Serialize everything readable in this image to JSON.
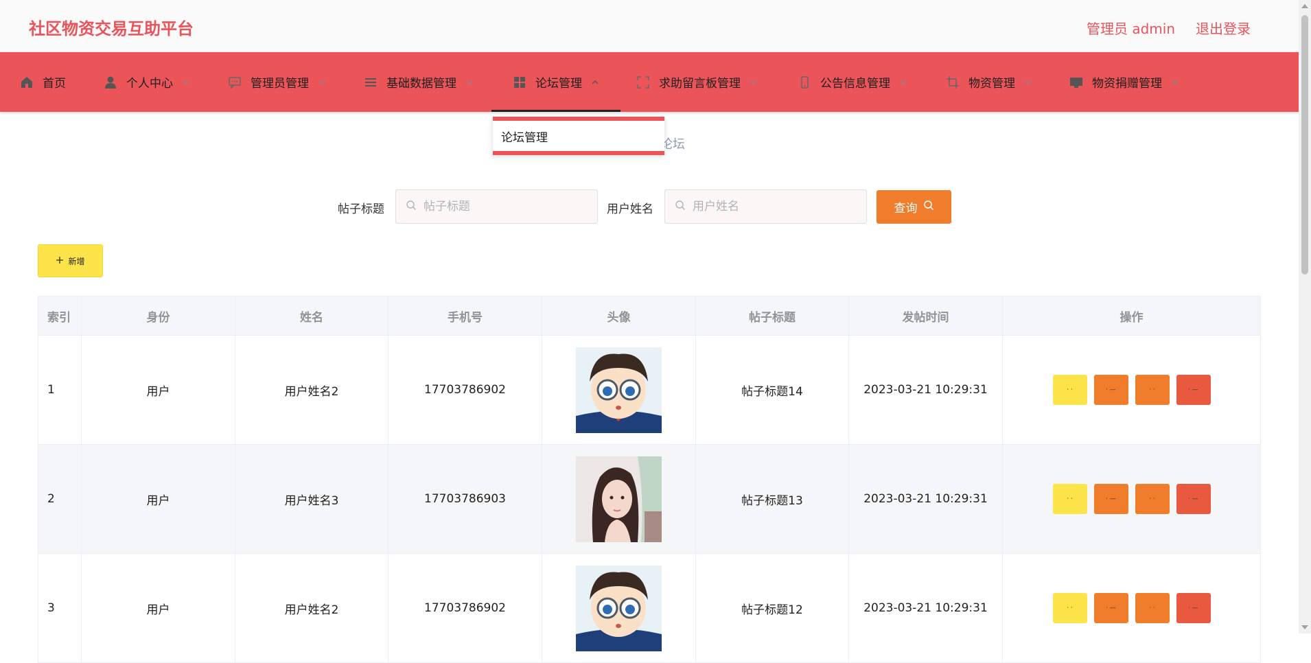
{
  "header": {
    "brand": "社区物资交易互助平台",
    "user_label": "管理员 admin",
    "logout_label": "退出登录"
  },
  "nav": {
    "items": [
      {
        "label": "首页",
        "icon": "home-icon"
      },
      {
        "label": "个人中心",
        "icon": "user-icon"
      },
      {
        "label": "管理员管理",
        "icon": "chat-icon"
      },
      {
        "label": "基础数据管理",
        "icon": "list-icon"
      },
      {
        "label": "论坛管理",
        "icon": "grid-icon"
      },
      {
        "label": "求助留言板管理",
        "icon": "fullscreen-icon"
      },
      {
        "label": "公告信息管理",
        "icon": "phone-icon"
      },
      {
        "label": "物资管理",
        "icon": "crop-icon"
      },
      {
        "label": "物资捐赠管理",
        "icon": "monitor-icon"
      }
    ],
    "dropdown_item": "论坛管理"
  },
  "breadcrumb": {
    "tail": "论坛"
  },
  "search": {
    "title_label": "帖子标题",
    "title_placeholder": "帖子标题",
    "name_label": "用户姓名",
    "name_placeholder": "用户姓名",
    "query_label": "查询"
  },
  "add_label": "新增",
  "table": {
    "columns": [
      "索引",
      "身份",
      "姓名",
      "手机号",
      "头像",
      "帖子标题",
      "发帖时间",
      "操作"
    ],
    "rows": [
      {
        "index": "1",
        "role": "用户",
        "name": "用户姓名2",
        "phone": "17703786902",
        "avatar": "cartoon-boy-glasses",
        "title": "帖子标题14",
        "time": "2023-03-21 10:29:31"
      },
      {
        "index": "2",
        "role": "用户",
        "name": "用户姓名3",
        "phone": "17703786903",
        "avatar": "illustrated-woman",
        "title": "帖子标题13",
        "time": "2023-03-21 10:29:31"
      },
      {
        "index": "3",
        "role": "用户",
        "name": "用户姓名2",
        "phone": "17703786902",
        "avatar": "cartoon-boy-glasses",
        "title": "帖子标题12",
        "time": "2023-03-21 10:29:31"
      }
    ]
  },
  "colors": {
    "accent": "#eb5458",
    "query": "#ef7d2c",
    "add": "#fde44a",
    "delete": "#e8593f"
  }
}
